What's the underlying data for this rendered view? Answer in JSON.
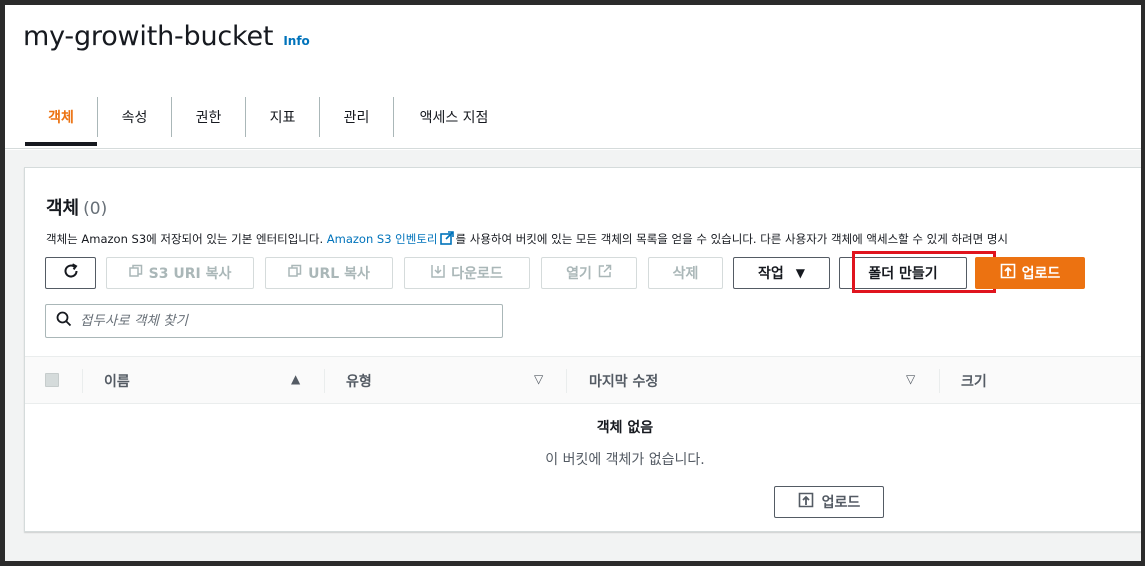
{
  "bucket": {
    "name": "my-growith-bucket",
    "info_link": "Info"
  },
  "tabs": [
    {
      "label": "객체",
      "active": true
    },
    {
      "label": "속성"
    },
    {
      "label": "권한"
    },
    {
      "label": "지표"
    },
    {
      "label": "관리"
    },
    {
      "label": "액세스 지점"
    }
  ],
  "objects": {
    "title": "객체",
    "count": "(0)",
    "description_pre": "객체는 Amazon S3에 저장되어 있는 기본 엔터티입니다. ",
    "description_link": "Amazon S3 인벤토리",
    "description_post": "를 사용하여 버킷에 있는 모든 객체의 목록을 얻을 수 있습니다. 다른 사용자가 객체에 액세스할 수 있게 하려면 명시"
  },
  "toolbar": {
    "refresh_icon": "refresh-icon",
    "copy_s3_uri": "S3 URI 복사",
    "copy_url": "URL 복사",
    "download": "다운로드",
    "open": "열기",
    "delete": "삭제",
    "actions": "작업",
    "create_folder": "폴더 만들기",
    "upload": "업로드"
  },
  "search": {
    "placeholder": "접두사로 객체 찾기"
  },
  "table": {
    "columns": [
      "이름",
      "유형",
      "마지막 수정",
      "크기"
    ]
  },
  "empty": {
    "title": "객체 없음",
    "description": "이 버킷에 객체가 없습니다.",
    "upload": "업로드"
  },
  "colors": {
    "accent": "#ec7211",
    "link": "#0073bb",
    "highlight": "#e0141e"
  }
}
